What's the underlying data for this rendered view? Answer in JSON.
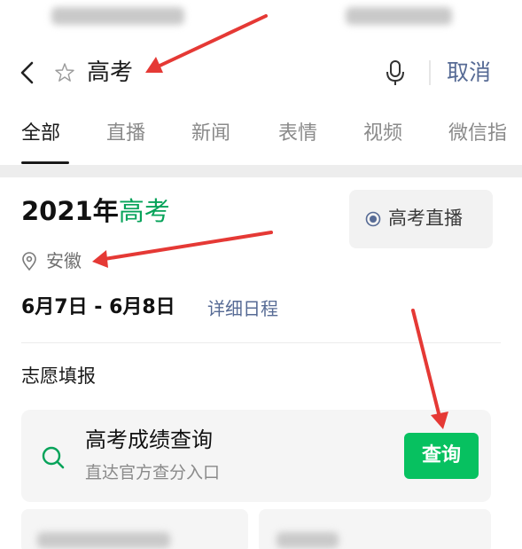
{
  "search": {
    "query": "高考",
    "cancel_label": "取消"
  },
  "tabs": [
    {
      "label": "全部",
      "active": true
    },
    {
      "label": "直播",
      "active": false
    },
    {
      "label": "新闻",
      "active": false
    },
    {
      "label": "表情",
      "active": false
    },
    {
      "label": "视频",
      "active": false
    },
    {
      "label": "微信指",
      "active": false
    }
  ],
  "exam_card": {
    "year_label": "2021年",
    "keyword": "高考",
    "live_button_label": "高考直播",
    "location": "安徽",
    "dates": "6月7日 - 6月8日",
    "schedule_link": "详细日程",
    "section_title": "志愿填报"
  },
  "score_query": {
    "title": "高考成绩查询",
    "subtitle": "直达官方查分入口",
    "button_label": "查询"
  },
  "icons": {
    "back": "back-arrow-icon",
    "star": "star-outline-icon",
    "mic": "microphone-icon",
    "live": "radio-dot-icon",
    "location": "location-pin-icon",
    "search": "search-icon"
  },
  "colors": {
    "accent_green": "#07a35a",
    "button_green": "#07c160",
    "link_blue": "#576b95",
    "annotation_red": "#e53935"
  }
}
